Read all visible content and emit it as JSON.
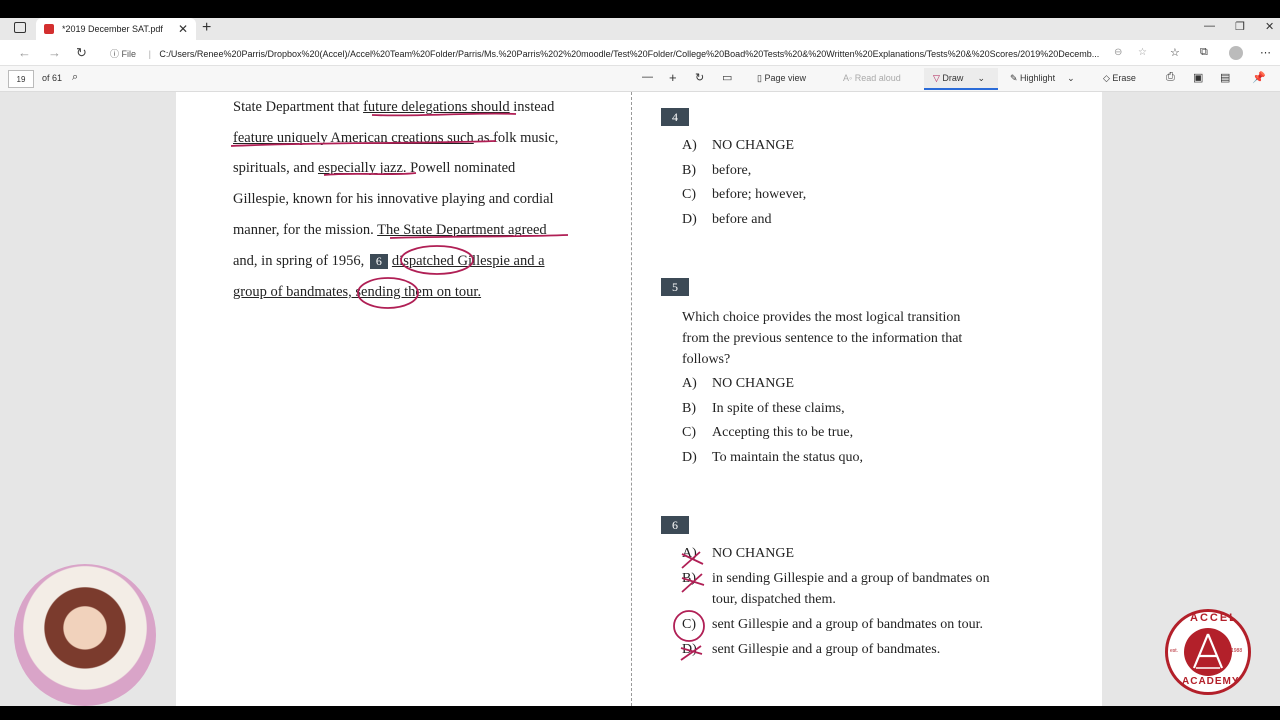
{
  "browser": {
    "tab_title": "*2019 December SAT.pdf",
    "file_label": "File",
    "url": "C:/Users/Renee%20Parris/Dropbox%20(Accel)/Accel%20Team%20Folder/Parris/Ms.%20Parris%202%20moodle/Test%20Folder/College%20Boad%20Tests%20&%20Written%20Explanations/Tests%20&%20Scores/2019%20Decemb..."
  },
  "pdf_toolbar": {
    "page_number": "19",
    "page_total": "of 61",
    "minus": "—",
    "plus": "+",
    "page_view": "Page view",
    "read_aloud": "Read aloud",
    "draw": "Draw",
    "highlight": "Highlight",
    "erase": "Erase"
  },
  "passage": {
    "l1a": "State Department that ",
    "l1b": "future delegations should",
    "l1c": " instead",
    "l2a": "feature uniquely American creations such",
    "l2b": " as folk music,",
    "l3a": "spirituals, and ",
    "l3b": "especially jazz.",
    "l3c": " Powell nominated",
    "l4": "Gillespie, known for his innovative playing and cordial",
    "l5a": "manner, for the mission. ",
    "l5b": "The State Department agreed",
    "l6a": "and, in spring of 1956, ",
    "l6num": "6",
    "l6b": "dispatched Gillespie and a",
    "l7": "group of bandmates, sending them on tour."
  },
  "q4": {
    "num": "4",
    "options": [
      {
        "letter": "A)",
        "text": "NO CHANGE"
      },
      {
        "letter": "B)",
        "text": "before,"
      },
      {
        "letter": "C)",
        "text": "before; however,"
      },
      {
        "letter": "D)",
        "text": "before and"
      }
    ]
  },
  "q5": {
    "num": "5",
    "stem1": "Which choice provides the most logical transition",
    "stem2": "from the previous sentence to the information that",
    "stem3": "follows?",
    "options": [
      {
        "letter": "A)",
        "text": "NO CHANGE"
      },
      {
        "letter": "B)",
        "text": "In spite of these claims,"
      },
      {
        "letter": "C)",
        "text": "Accepting this to be true,"
      },
      {
        "letter": "D)",
        "text": "To maintain the status quo,"
      }
    ]
  },
  "q6": {
    "num": "6",
    "options": [
      {
        "letter": "A)",
        "text": "NO CHANGE"
      },
      {
        "letter": "B)",
        "text": "in sending Gillespie and a group of bandmates on",
        "text2": "tour, dispatched them."
      },
      {
        "letter": "C)",
        "text": "sent Gillespie and a group of bandmates on tour."
      },
      {
        "letter": "D)",
        "text": "sent Gillespie and a group of bandmates."
      }
    ]
  },
  "logo": {
    "top": "ACCEL",
    "bottom": "ACADEMY",
    "est": "est.",
    "year": "1988"
  },
  "colors": {
    "ink": "#b01f55",
    "qbox": "#3c4a56",
    "logo": "#b3202a"
  }
}
